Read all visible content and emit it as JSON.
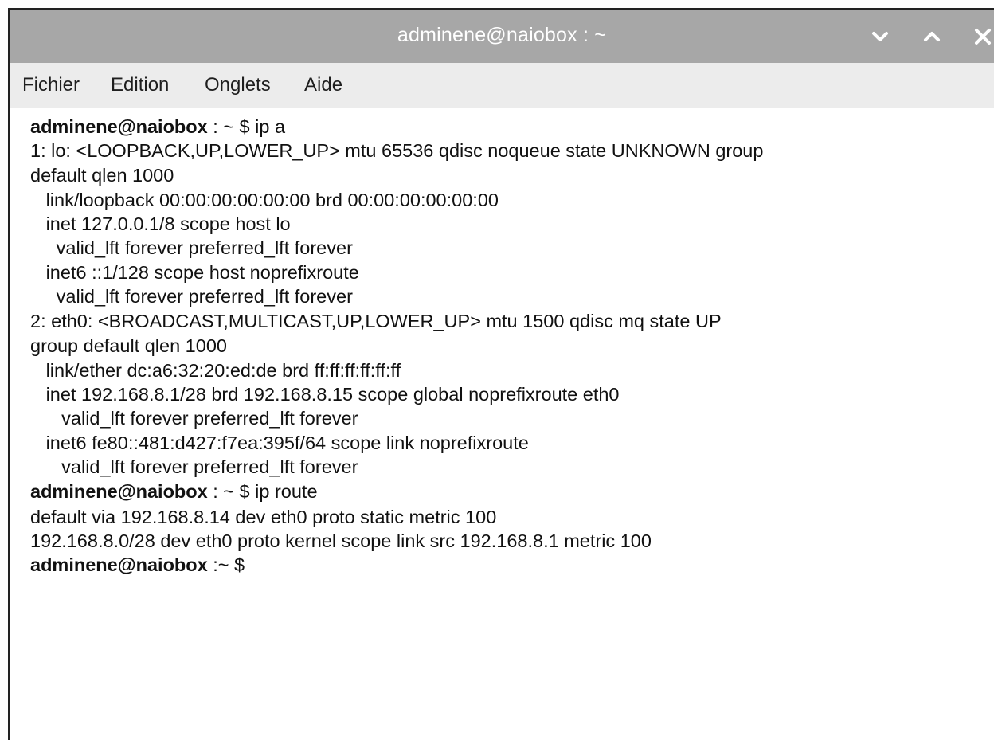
{
  "window": {
    "title": "adminene@naiobox : ~",
    "controls": [
      "chevron-down-icon",
      "chevron-up-icon",
      "close-icon"
    ]
  },
  "menu": {
    "items": [
      "Fichier",
      "Edition",
      "Onglets",
      "Aide"
    ]
  },
  "terminal": {
    "prompt_user": "adminene@naiobox",
    "lines": [
      {
        "prompt": "adminene@naiobox",
        "text": " : ~ $ ip a"
      },
      {
        "text": "1: lo: <LOOPBACK,UP,LOWER_UP> mtu 65536 qdisc noqueue state UNKNOWN group"
      },
      {
        "text": "default qlen 1000"
      },
      {
        "text": "   link/loopback 00:00:00:00:00:00 brd 00:00:00:00:00:00"
      },
      {
        "text": "   inet 127.0.0.1/8 scope host lo"
      },
      {
        "text": "     valid_lft forever preferred_lft forever"
      },
      {
        "text": "   inet6 ::1/128 scope host noprefixroute"
      },
      {
        "text": "     valid_lft forever preferred_lft forever"
      },
      {
        "text": "2: eth0: <BROADCAST,MULTICAST,UP,LOWER_UP> mtu 1500 qdisc mq state UP"
      },
      {
        "text": "group default qlen 1000"
      },
      {
        "text": "   link/ether dc:a6:32:20:ed:de brd ff:ff:ff:ff:ff:ff"
      },
      {
        "text": "   inet 192.168.8.1/28 brd 192.168.8.15 scope global noprefixroute eth0"
      },
      {
        "text": "      valid_lft forever preferred_lft forever"
      },
      {
        "text": "   inet6 fe80::481:d427:f7ea:395f/64 scope link noprefixroute"
      },
      {
        "text": "      valid_lft forever preferred_lft forever"
      },
      {
        "prompt": "adminene@naiobox",
        "text": " : ~ $ ip route"
      },
      {
        "text": "default via 192.168.8.14 dev eth0 proto static metric 100"
      },
      {
        "text": "192.168.8.0/28 dev eth0 proto kernel scope link src 192.168.8.1 metric 100"
      },
      {
        "prompt": "adminene@naiobox",
        "text": " :~ $"
      }
    ]
  },
  "colors": {
    "titlebar": "#a7a7a7",
    "menubar": "#ececec",
    "text": "#111111"
  }
}
